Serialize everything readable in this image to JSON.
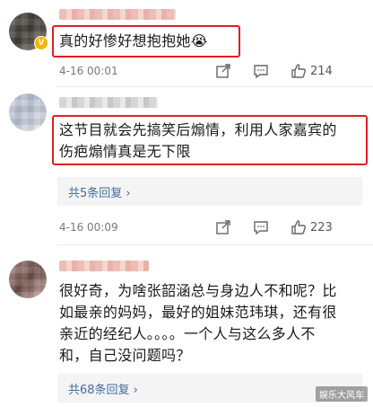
{
  "comments": [
    {
      "text": "真的好惨好想抱抱她😭",
      "timestamp": "4-16 00:01",
      "likes": "214",
      "verified_badge": "V"
    },
    {
      "text_line1": "这节目就会先搞笑后煽情，利用人家嘉宾的",
      "text_line2": "伤疤煽情真是无下限",
      "replies_label": "共5条回复 ›",
      "timestamp": "4-16 00:09",
      "likes": "223"
    },
    {
      "text_line1": "很好奇，为啥张韶涵总与身边人不和呢？比",
      "text_line2": "如最亲的妈妈，最好的姐妹范玮琪，还有很",
      "text_line3": "亲近的经纪人。。。。一个人与这么多人不",
      "text_line4": "和，自己没问题吗？",
      "replies_label": "共68条回复 ›"
    }
  ],
  "watermark": "娱乐大风车",
  "colors": {
    "highlight_border": "#e02020",
    "link": "#456d9d",
    "meta": "#7a7a7a"
  },
  "icons": [
    "share-icon",
    "comment-icon",
    "like-icon"
  ]
}
